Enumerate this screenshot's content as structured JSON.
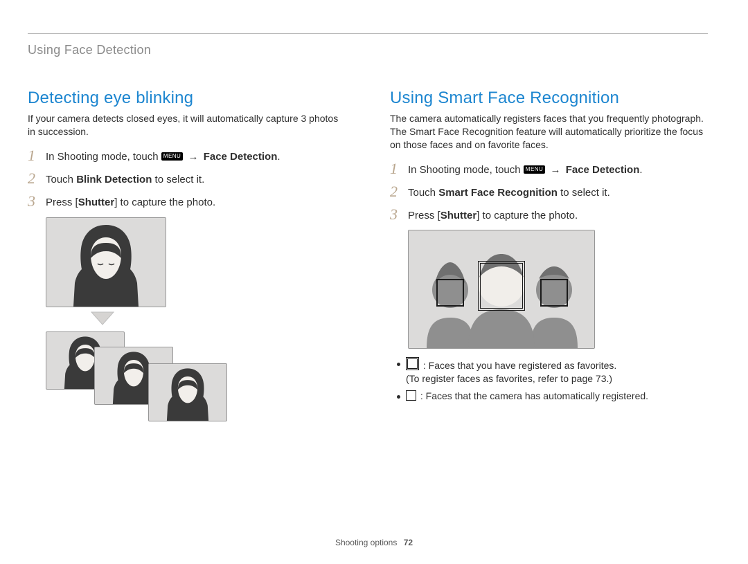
{
  "header": {
    "title": "Using Face Detection"
  },
  "icons": {
    "menu": "MENU",
    "arrow": "→"
  },
  "left": {
    "title": "Detecting eye blinking",
    "intro": "If your camera detects closed eyes, it will automatically capture 3 photos in succession.",
    "steps": [
      {
        "num": "1",
        "pre": "In Shooting mode, touch ",
        "bold": "Face Detection",
        "post": "."
      },
      {
        "num": "2",
        "pre": "Touch ",
        "bold": "Blink Detection",
        "post": " to select it."
      },
      {
        "num": "3",
        "pre": "Press [",
        "bold": "Shutter",
        "post": "] to capture the photo."
      }
    ]
  },
  "right": {
    "title": "Using Smart Face Recognition",
    "intro": "The camera automatically registers faces that you frequently photograph. The Smart Face Recognition feature will automatically prioritize the focus on those faces and on favorite faces.",
    "steps": [
      {
        "num": "1",
        "pre": "In Shooting mode, touch ",
        "bold": "Face Detection",
        "post": "."
      },
      {
        "num": "2",
        "pre": "Touch ",
        "bold": "Smart Face Recognition",
        "post": " to select it."
      },
      {
        "num": "3",
        "pre": "Press [",
        "bold": "Shutter",
        "post": "] to capture the photo."
      }
    ],
    "legend": [
      {
        "line1": ": Faces that you have registered as favorites.",
        "line2": "(To register faces as favorites, refer to page 73.)"
      },
      {
        "line1": ": Faces that the camera has automatically registered."
      }
    ]
  },
  "footer": {
    "section": "Shooting options",
    "page": "72"
  }
}
